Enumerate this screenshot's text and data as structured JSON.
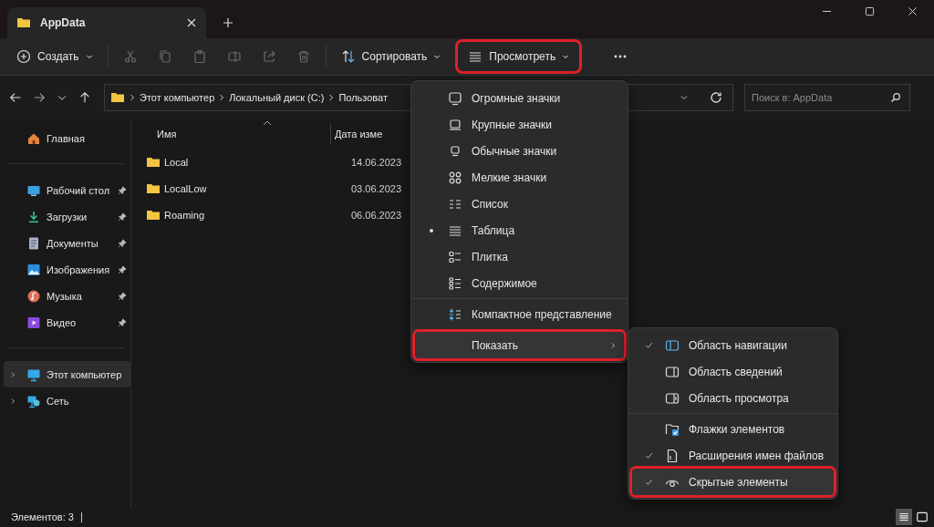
{
  "window": {
    "tab_title": "AppData"
  },
  "toolbar": [
    {
      "kind": "new",
      "label": "Создать",
      "disabled": false,
      "highlighted": false
    },
    {
      "kind": "cut",
      "disabled": true,
      "highlighted": false
    },
    {
      "kind": "copy",
      "disabled": true,
      "highlighted": false
    },
    {
      "kind": "paste",
      "disabled": true,
      "highlighted": false
    },
    {
      "kind": "rename",
      "disabled": true,
      "highlighted": false
    },
    {
      "kind": "share",
      "disabled": true,
      "highlighted": false
    },
    {
      "kind": "delete",
      "disabled": true,
      "highlighted": false
    },
    {
      "kind": "sort",
      "label": "Сортировать",
      "disabled": false,
      "highlighted": false
    },
    {
      "kind": "view",
      "label": "Просмотреть",
      "disabled": false,
      "highlighted": true
    },
    {
      "kind": "more",
      "disabled": false,
      "highlighted": false
    }
  ],
  "address": {
    "breadcrumbs": [
      "Этот компьютер",
      "Локальный диск (C:)",
      "Пользоват"
    ],
    "search_placeholder": "Поиск в: AppData"
  },
  "sidebar": [
    [
      {
        "label": "Главная",
        "pinned": false,
        "selected": false
      }
    ],
    [
      {
        "label": "Рабочий стол",
        "pinned": true,
        "selected": false
      },
      {
        "label": "Загрузки",
        "pinned": true,
        "selected": false
      },
      {
        "label": "Документы",
        "pinned": true,
        "selected": false
      },
      {
        "label": "Изображения",
        "pinned": true,
        "selected": false
      },
      {
        "label": "Музыка",
        "pinned": true,
        "selected": false
      },
      {
        "label": "Видео",
        "pinned": true,
        "selected": false
      }
    ],
    [
      {
        "label": "Этот компьютер",
        "pinned": false,
        "selected": true,
        "expanded": false
      },
      {
        "label": "Сеть",
        "pinned": false,
        "selected": false,
        "expanded": false
      }
    ]
  ],
  "files": {
    "columns": [
      "Имя",
      "Дата изме"
    ],
    "rows": [
      {
        "name": "Local",
        "date": "14.06.2023"
      },
      {
        "name": "LocalLow",
        "date": "03.06.2023"
      },
      {
        "name": "Roaming",
        "date": "06.06.2023"
      }
    ]
  },
  "view_menu": [
    [
      {
        "kind": "radio",
        "label": "Огромные значки",
        "selected": false,
        "highlighted": false
      },
      {
        "kind": "radio",
        "label": "Крупные значки",
        "selected": false,
        "highlighted": false
      },
      {
        "kind": "radio",
        "label": "Обычные значки",
        "selected": false,
        "highlighted": false
      },
      {
        "kind": "radio",
        "label": "Мелкие значки",
        "selected": false,
        "highlighted": false
      },
      {
        "kind": "radio",
        "label": "Список",
        "selected": false,
        "highlighted": false
      },
      {
        "kind": "radio",
        "label": "Таблица",
        "selected": true,
        "highlighted": false
      },
      {
        "kind": "radio",
        "label": "Плитка",
        "selected": false,
        "highlighted": false
      },
      {
        "kind": "radio",
        "label": "Содержимое",
        "selected": false,
        "highlighted": false
      }
    ],
    [
      {
        "kind": "check",
        "label": "Компактное представление",
        "selected": false,
        "highlighted": false
      }
    ],
    [
      {
        "kind": "submenu",
        "label": "Показать",
        "selected": false,
        "highlighted": true
      }
    ]
  ],
  "show_menu": [
    [
      {
        "label": "Область навигации",
        "checked": true,
        "highlighted": false
      },
      {
        "label": "Область сведений",
        "checked": false,
        "highlighted": false
      },
      {
        "label": "Область просмотра",
        "checked": false,
        "highlighted": false
      }
    ],
    [
      {
        "label": "Флажки элементов",
        "checked": false,
        "highlighted": false
      },
      {
        "label": "Расширения имен файлов",
        "checked": true,
        "highlighted": false
      },
      {
        "label": "Скрытые элементы",
        "checked": true,
        "highlighted": true
      }
    ]
  ],
  "status_bar": {
    "count": "Элементов: 3",
    "view_buttons": [
      {
        "selected": true
      },
      {
        "selected": false
      }
    ]
  }
}
